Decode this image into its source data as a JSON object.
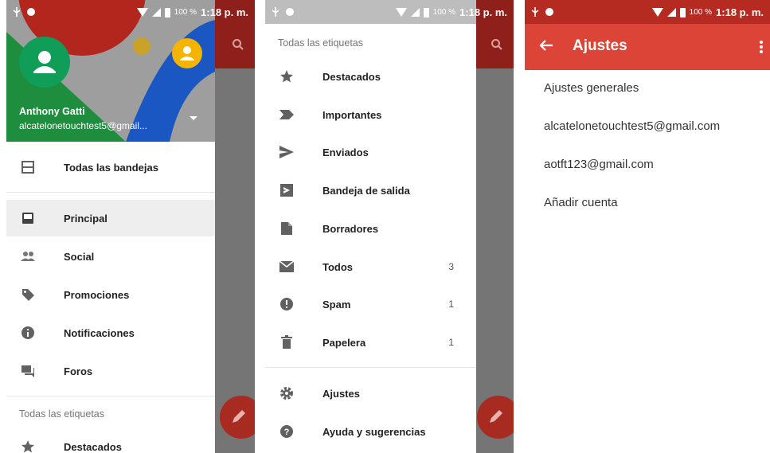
{
  "status": {
    "battery": "100 %",
    "time": "1:18 p. m."
  },
  "panel1": {
    "account": {
      "name": "Anthony Gatti",
      "email": "alcatelonetouchtest5@gmail..."
    },
    "items": [
      {
        "label": "Todas las bandejas",
        "icon": "all-inboxes-icon"
      },
      {
        "label": "Principal",
        "icon": "inbox-icon",
        "selected": true
      },
      {
        "label": "Social",
        "icon": "people-icon"
      },
      {
        "label": "Promociones",
        "icon": "tag-icon"
      },
      {
        "label": "Notificaciones",
        "icon": "info-icon"
      },
      {
        "label": "Foros",
        "icon": "forum-icon"
      }
    ],
    "section": "Todas las etiquetas",
    "after_section": [
      {
        "label": "Destacados",
        "icon": "star-icon"
      }
    ]
  },
  "panel2": {
    "section": "Todas las etiquetas",
    "items": [
      {
        "label": "Destacados",
        "icon": "star-icon",
        "count": ""
      },
      {
        "label": "Importantes",
        "icon": "important-icon",
        "count": ""
      },
      {
        "label": "Enviados",
        "icon": "send-icon",
        "count": ""
      },
      {
        "label": "Bandeja de salida",
        "icon": "outbox-icon",
        "count": ""
      },
      {
        "label": "Borradores",
        "icon": "draft-icon",
        "count": ""
      },
      {
        "label": "Todos",
        "icon": "all-mail-icon",
        "count": "3"
      },
      {
        "label": "Spam",
        "icon": "spam-icon",
        "count": "1"
      },
      {
        "label": "Papelera",
        "icon": "trash-icon",
        "count": "1"
      }
    ],
    "footer": [
      {
        "label": "Ajustes",
        "icon": "gear-icon"
      },
      {
        "label": "Ayuda y sugerencias",
        "icon": "help-icon"
      }
    ]
  },
  "panel3": {
    "title": "Ajustes",
    "items": [
      "Ajustes generales",
      "alcatelonetouchtest5@gmail.com",
      "aotft123@gmail.com",
      "Añadir cuenta"
    ]
  },
  "colors": {
    "primary": "#db4437",
    "dark_primary": "#b52b21",
    "avatar_green": "#0f9d58",
    "avatar_yellow": "#f4b400"
  }
}
